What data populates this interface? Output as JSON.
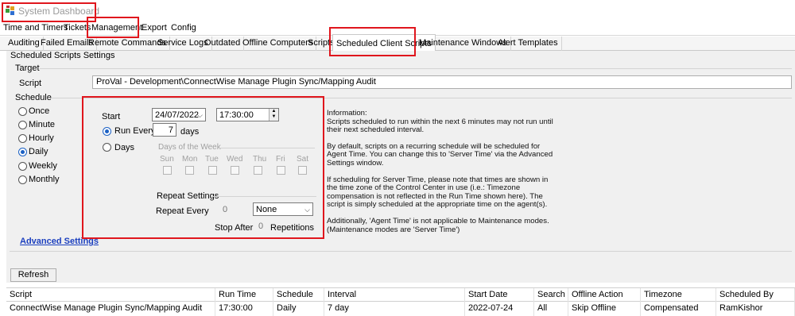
{
  "window": {
    "title": "System Dashboard",
    "icon": "app-grid-icon"
  },
  "menu": [
    "Time and Timers",
    "Tickets",
    "Management",
    "Export",
    "Config"
  ],
  "tabs": [
    "Auditing",
    "Failed Emails",
    "Remote Commands",
    "Service Logs",
    "Outdated",
    "Offline Computers",
    "Scripts",
    "Scheduled Client Scripts",
    "Maintenance Windows",
    "Alert Templates"
  ],
  "active_tab": "Scheduled Client Scripts",
  "settings_title": "Scheduled Scripts Settings",
  "target": {
    "label": "Target",
    "script_label": "Script",
    "script_value": "ProVal - Development\\ConnectWise Manage Plugin Sync/Mapping Audit"
  },
  "schedule": {
    "label": "Schedule",
    "options": [
      "Once",
      "Minute",
      "Hourly",
      "Daily",
      "Weekly",
      "Monthly"
    ],
    "selected": "Daily"
  },
  "timing": {
    "start_label": "Start",
    "start_date": "24/07/2022",
    "start_time": "17:30:00",
    "run_every_label": "Run Every",
    "run_every_value": "7",
    "days_unit": "days",
    "days_label": "Days",
    "dow_title": "Days of the Week",
    "dow": [
      "Sun",
      "Mon",
      "Tue",
      "Wed",
      "Thu",
      "Fri",
      "Sat"
    ],
    "repeat_title": "Repeat Settings",
    "repeat_every_label": "Repeat Every",
    "repeat_every_value": "0",
    "repeat_unit": "None",
    "stop_after_label": "Stop After",
    "stop_after_value": "0",
    "repetitions_label": "Repetitions"
  },
  "info": {
    "p1": "Information:\nScripts scheduled to run within the next 6 minutes may not run until their next scheduled interval.",
    "p2": "By default, scripts on a recurring schedule will be scheduled for Agent Time. You can change this to 'Server Time' via the Advanced Settings window.",
    "p3": "If scheduling for Server Time, please note that times are shown in the time zone of the Control Center in use (i.e.: Timezone compensation is not reflected in the Run Time shown here). The script is simply scheduled at the appropriate time on the agent(s).",
    "p4": "Additionally, 'Agent Time' is not applicable to Maintenance modes. (Maintenance modes are 'Server Time')"
  },
  "advanced_link": "Advanced Settings",
  "refresh_label": "Refresh",
  "grid": {
    "columns": [
      "Script",
      "Run Time",
      "Schedule",
      "Interval",
      "Start Date",
      "Search",
      "Offline Action",
      "Timezone",
      "Scheduled By"
    ],
    "rows": [
      [
        "ConnectWise Manage Plugin Sync/Mapping Audit",
        "17:30:00",
        "Daily",
        "7 day",
        "2022-07-24",
        "All",
        "Skip Offline",
        "Compensated",
        "RamKishor"
      ]
    ]
  },
  "colors": {
    "highlight": "#e0161d",
    "radio_checked": "#1c61c4",
    "link": "#1b3fbf"
  }
}
